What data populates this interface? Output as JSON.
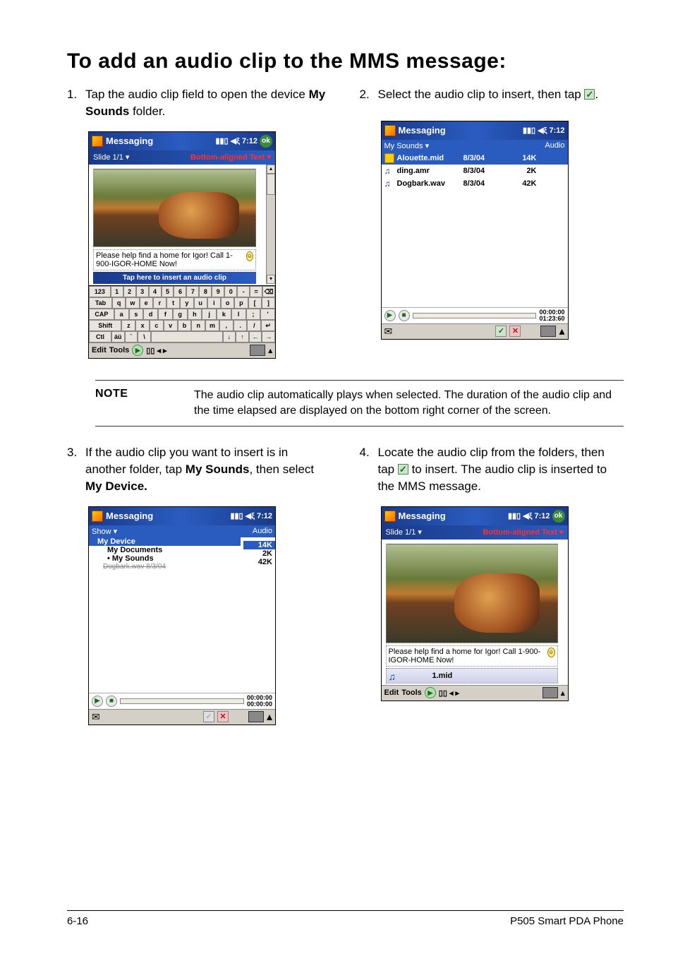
{
  "heading": "To add an audio clip to the MMS message:",
  "steps": {
    "s1": {
      "num": "1.",
      "pre": "Tap the audio clip field to open the device ",
      "bold": "My Sounds",
      "post": " folder."
    },
    "s2": {
      "num": "2.",
      "pre": "Select the audio clip to insert, then tap ",
      "post": "."
    },
    "s3": {
      "num": "3.",
      "pre": "If the audio clip you want to insert is in another folder, tap ",
      "bold1": "My Sounds",
      "mid": ", then select ",
      "bold2": "My Device.",
      "post": ""
    },
    "s4": {
      "num": "4.",
      "pre": "Locate the audio clip from the folders, then tap ",
      "mid": " to insert. The audio clip is inserted to the MMS message."
    }
  },
  "note": {
    "label": "NOTE",
    "text": "The audio clip automatically plays when selected. The duration of the audio clip and the time elapsed are displayed on the bottom right corner of the screen."
  },
  "pda_common": {
    "title": "Messaging",
    "signal": "📶",
    "speaker": "◀",
    "time": "7:12",
    "ok": "ok"
  },
  "shot1": {
    "slide": "Slide 1/1 ▾",
    "align": "Bottom-aligned Text ▾",
    "textmsg": "Please help find a home for Igor! Call 1-900-IGOR-HOME Now!",
    "audio_prompt": "Tap here to insert an audio clip",
    "bottom": {
      "edit": "Edit",
      "tools": "Tools"
    },
    "kbd": {
      "r1": [
        "123",
        "1",
        "2",
        "3",
        "4",
        "5",
        "6",
        "7",
        "8",
        "9",
        "0",
        "-",
        "=",
        "⌫"
      ],
      "r2": [
        "Tab",
        "q",
        "w",
        "e",
        "r",
        "t",
        "y",
        "u",
        "i",
        "o",
        "p",
        "[",
        "]"
      ],
      "r3": [
        "CAP",
        "a",
        "s",
        "d",
        "f",
        "g",
        "h",
        "j",
        "k",
        "l",
        ";",
        "'"
      ],
      "r4": [
        "Shift",
        "z",
        "x",
        "c",
        "v",
        "b",
        "n",
        "m",
        ",",
        ".",
        "/",
        "↵"
      ],
      "r5": [
        "Ctl",
        "áü",
        "`",
        "\\",
        "",
        "↓",
        "↑",
        "←",
        "→"
      ]
    }
  },
  "shot2": {
    "header_left": "My Sounds ▾",
    "header_right": "Audio",
    "files": [
      {
        "name": "Alouette.mid",
        "date": "8/3/04",
        "size": "14K",
        "type": "mid",
        "sel": true
      },
      {
        "name": "ding.amr",
        "date": "8/3/04",
        "size": "2K",
        "type": "snd",
        "sel": false
      },
      {
        "name": "Dogbark.wav",
        "date": "8/3/04",
        "size": "42K",
        "type": "snd",
        "sel": false
      }
    ],
    "time1": "00:00:00",
    "time2": "01:23:60"
  },
  "shot3": {
    "header_left": "Show ▾",
    "header_right": "Audio",
    "tree": {
      "device": "My Device",
      "docs": "My Documents",
      "sounds": "My Sounds",
      "faded": "Dogbark.wav    8/3/04"
    },
    "sizes": [
      "14K",
      "2K",
      "42K"
    ],
    "time1": "00:00:00",
    "time2": "00:00:00"
  },
  "shot4": {
    "slide": "Slide 1/1 ▾",
    "align": "Bottom-aligned Text ▾",
    "textmsg": "Please help find a home for Igor! Call 1-900-IGOR-HOME Now!",
    "audio_name": "1.mid",
    "bottom": {
      "edit": "Edit",
      "tools": "Tools"
    }
  },
  "footer": {
    "left": "6-16",
    "right": "P505 Smart PDA Phone"
  }
}
